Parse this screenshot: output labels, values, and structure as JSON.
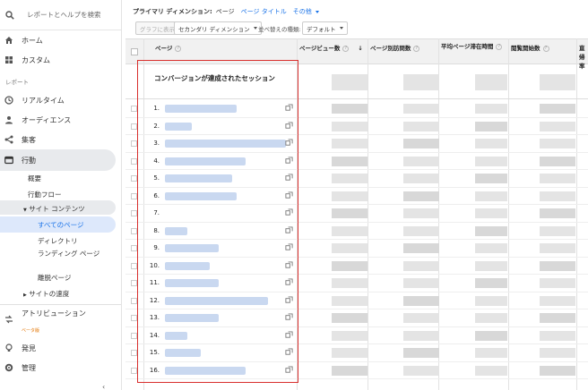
{
  "sidebar": {
    "search_placeholder": "レポートとヘルプを検索",
    "items": [
      {
        "label": "ホーム",
        "icon": "home-icon"
      },
      {
        "label": "カスタム",
        "icon": "grid-icon"
      }
    ],
    "section_report": "レポート",
    "reports": [
      {
        "label": "リアルタイム",
        "icon": "clock-icon"
      },
      {
        "label": "オーディエンス",
        "icon": "person-icon"
      },
      {
        "label": "集客",
        "icon": "acquisition-icon"
      },
      {
        "label": "行動",
        "icon": "behavior-icon"
      }
    ],
    "behavior_sub": [
      "概要",
      "行動フロー"
    ],
    "site_content": "サイト コンテンツ",
    "site_content_sub": [
      "すべてのページ",
      "ディレクトリ",
      "ランディング ページ",
      "離脱ページ"
    ],
    "site_speed": "サイトの速度",
    "attribution": "アトリビューション",
    "beta": "ベータ版",
    "discover": "発見",
    "admin": "管理"
  },
  "topbar": {
    "primary_dimension_label": "プライマリ ディメンション:",
    "primary_dimension_value": "ページ",
    "page_title_link": "ページ タイトル",
    "other_link": "その他"
  },
  "toolbar": {
    "graph_button": "グラフに表示",
    "secondary_dimension": "セカンダリ ディメンション",
    "sort_type_label": "並べ替えの種類:",
    "sort_default": "デフォルト"
  },
  "table": {
    "headers": {
      "page": "ページ",
      "pageviews": "ページビュー数",
      "unique_pageviews": "ページ別訪問数",
      "avg_time": "平均ページ滞在時間",
      "entrances": "閲覧開始数",
      "bounce": "直帰率"
    },
    "row_numbers": [
      "1.",
      "2.",
      "3.",
      "4.",
      "5.",
      "6.",
      "7.",
      "8.",
      "9.",
      "10.",
      "11.",
      "12.",
      "13.",
      "14.",
      "15.",
      "16."
    ]
  },
  "annotation": {
    "title": "コンバージョンが達成されたセッション",
    "color": "#d9302e"
  },
  "colors": {
    "accent": "#1a73e8",
    "beta": "#e37400"
  }
}
